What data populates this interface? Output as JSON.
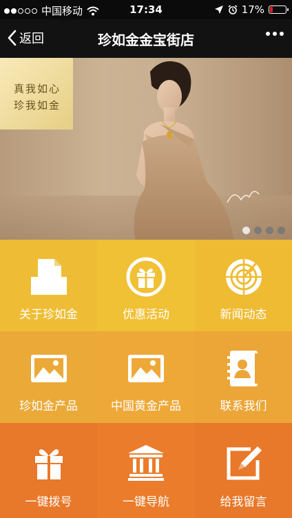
{
  "status_bar": {
    "signal_dots": [
      true,
      true,
      false,
      false,
      false
    ],
    "carrier": "中国移动",
    "time": "17:34",
    "battery_percent": "17%",
    "battery_level": 0.17,
    "battery_color": "#e02020"
  },
  "nav": {
    "back_label": "返回",
    "title": "珍如金金宝街店"
  },
  "banner": {
    "slogan_line1": "真我如心",
    "slogan_line2": "珍我如金",
    "page_count": 4,
    "active_page": 0
  },
  "menu": [
    {
      "label": "关于珍如金",
      "icon": "document-tray-icon",
      "color": "#eebd35"
    },
    {
      "label": "优惠活动",
      "icon": "gift-circle-icon",
      "color": "#f0c035"
    },
    {
      "label": "新闻动态",
      "icon": "radar-icon",
      "color": "#eebb33"
    },
    {
      "label": "珍如金产品",
      "icon": "image-icon",
      "color": "#eba938"
    },
    {
      "label": "中国黄金产品",
      "icon": "image-icon",
      "color": "#eea838"
    },
    {
      "label": "联系我们",
      "icon": "contact-book-icon",
      "color": "#eca537"
    },
    {
      "label": "一键拨号",
      "icon": "gift-icon",
      "color": "#e8782a"
    },
    {
      "label": "一键导航",
      "icon": "bank-icon",
      "color": "#ea7c2b"
    },
    {
      "label": "给我留言",
      "icon": "edit-icon",
      "color": "#e8782a"
    }
  ]
}
